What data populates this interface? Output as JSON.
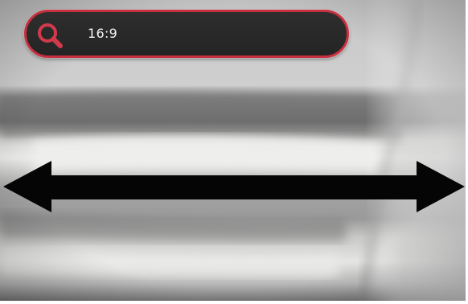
{
  "zoom_bar": {
    "value_label": "16:9",
    "icon": "search-icon",
    "border_color": "#c9303f",
    "background_color": "#2a2a2a"
  },
  "gesture_hint": {
    "icon": "double-arrow-horizontal-icon",
    "color": "#050505"
  }
}
